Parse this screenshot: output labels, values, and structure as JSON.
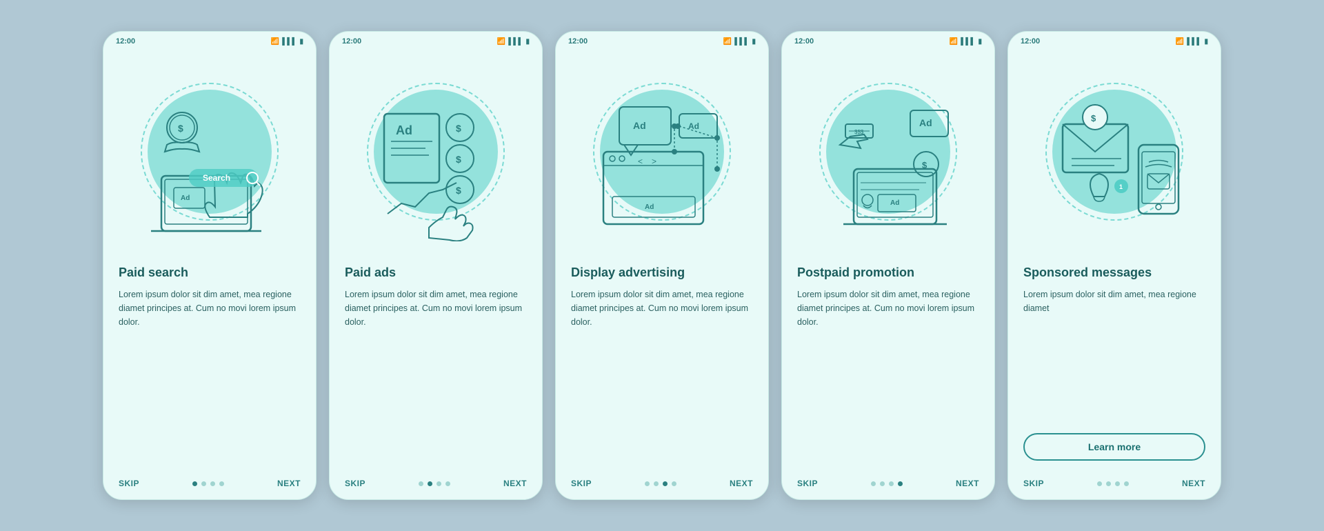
{
  "background_color": "#b0c8d4",
  "cards": [
    {
      "id": "paid-search",
      "status_time": "12:00",
      "title": "Paid search",
      "body": "Lorem ipsum dolor sit dim amet, mea regione diamet principes at. Cum no movi lorem ipsum dolor.",
      "has_learn_more": false,
      "dots": [
        true,
        false,
        false,
        false
      ],
      "skip_label": "SKIP",
      "next_label": "NEXT"
    },
    {
      "id": "paid-ads",
      "status_time": "12:00",
      "title": "Paid ads",
      "body": "Lorem ipsum dolor sit dim amet, mea regione diamet principes at. Cum no movi lorem ipsum dolor.",
      "has_learn_more": false,
      "dots": [
        false,
        true,
        false,
        false
      ],
      "skip_label": "SKIP",
      "next_label": "NEXT"
    },
    {
      "id": "display-advertising",
      "status_time": "12:00",
      "title": "Display advertising",
      "body": "Lorem ipsum dolor sit dim amet, mea regione diamet principes at. Cum no movi lorem ipsum dolor.",
      "has_learn_more": false,
      "dots": [
        false,
        false,
        true,
        false
      ],
      "skip_label": "SKIP",
      "next_label": "NEXT"
    },
    {
      "id": "postpaid-promotion",
      "status_time": "12:00",
      "title": "Postpaid promotion",
      "body": "Lorem ipsum dolor sit dim amet, mea regione diamet principes at. Cum no movi lorem ipsum dolor.",
      "has_learn_more": false,
      "dots": [
        false,
        false,
        false,
        true
      ],
      "skip_label": "SKIP",
      "next_label": "NEXT"
    },
    {
      "id": "sponsored-messages",
      "status_time": "12:00",
      "title": "Sponsored messages",
      "body": "Lorem ipsum dolor sit dim amet, mea regione diamet",
      "has_learn_more": true,
      "learn_more_label": "Learn more",
      "dots": [
        false,
        false,
        false,
        false
      ],
      "skip_label": "SKIP",
      "next_label": "NEXT"
    }
  ]
}
